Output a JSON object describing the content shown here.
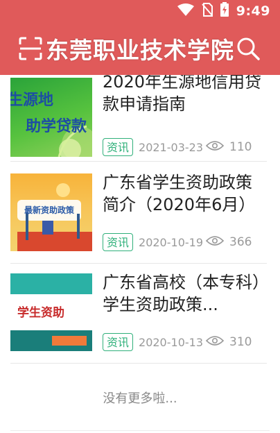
{
  "status": {
    "time": "9:49"
  },
  "header": {
    "title": "东莞职业技术学院"
  },
  "news": [
    {
      "title": "2020年生源地信用贷款申请指南",
      "tag": "资讯",
      "date": "2021-03-23",
      "views": "110",
      "thumb_lines": [
        "生源地",
        "助学贷款"
      ]
    },
    {
      "title": "广东省学生资助政策简介（2020年6月）",
      "tag": "资讯",
      "date": "2020-10-19",
      "views": "366",
      "thumb_lines": [
        "最新资助政策"
      ]
    },
    {
      "title": "广东省高校（本专科）学生资助政策...",
      "tag": "资讯",
      "date": "2020-10-13",
      "views": "310",
      "thumb_lines": [
        "学生资助"
      ]
    }
  ],
  "footer": {
    "no_more": "没有更多啦..."
  },
  "colors": {
    "header_bg": "#e05a5a",
    "tag_green": "#2fb07a",
    "meta_gray": "#9a9a9a"
  }
}
